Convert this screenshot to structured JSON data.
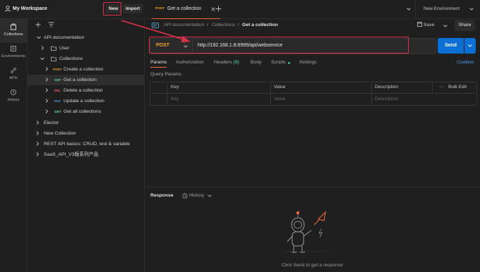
{
  "workspace": {
    "title": "My Workspace",
    "new_label": "New",
    "import_label": "Import"
  },
  "rail": {
    "items": [
      {
        "label": "Collections",
        "icon": "collections-icon"
      },
      {
        "label": "Environments",
        "icon": "environments-icon"
      },
      {
        "label": "APIs",
        "icon": "apis-icon"
      },
      {
        "label": "History",
        "icon": "history-icon"
      }
    ]
  },
  "tree": {
    "root": "API documentation",
    "user": "User",
    "collections": "Collections",
    "requests": [
      {
        "method": "POST",
        "name": "Create a collection"
      },
      {
        "method": "GET",
        "name": "Get a collection"
      },
      {
        "method": "DEL",
        "name": "Delete a collection"
      },
      {
        "method": "PUT",
        "name": "Update a collection"
      },
      {
        "method": "GET",
        "name": "Get all collections"
      }
    ],
    "others": [
      "Elector",
      "New Collection",
      "REST API basics: CRUD, test & variable",
      "SaaS_API_V3版系列产品"
    ]
  },
  "tab": {
    "method": "POST",
    "name": "Get a collection"
  },
  "environment": "New Environment",
  "breadcrumb": {
    "root": "API documentation",
    "sep1": "/",
    "folder": "Collections",
    "sep2": "/",
    "current": "Get a collection"
  },
  "actions": {
    "save": "Save",
    "share": "Share"
  },
  "request": {
    "method": "POST",
    "url": "http://192.168.1.8:8999/api/webservice",
    "send": "Send"
  },
  "pane_tabs": {
    "params": "Params",
    "authorization": "Authorization",
    "headers": "Headers",
    "headers_count": "(9)",
    "body": "Body",
    "scripts": "Scripts",
    "settings": "Settings",
    "cookies": "Cookies"
  },
  "query": {
    "title": "Query Params",
    "headers": {
      "key": "Key",
      "value": "Value",
      "description": "Description",
      "bulk": "Bulk Edit"
    },
    "placeholder": {
      "key": "Key",
      "value": "Value",
      "description": "Description"
    }
  },
  "response": {
    "title": "Response",
    "history": "History",
    "hint": "Click Send to get a response"
  },
  "colors": {
    "post": "#f5a623",
    "get": "#6bdd9a",
    "del": "#f05b5b",
    "put": "#4a9eff",
    "send": "#0c6fd6",
    "highlight": "#e0314b"
  }
}
